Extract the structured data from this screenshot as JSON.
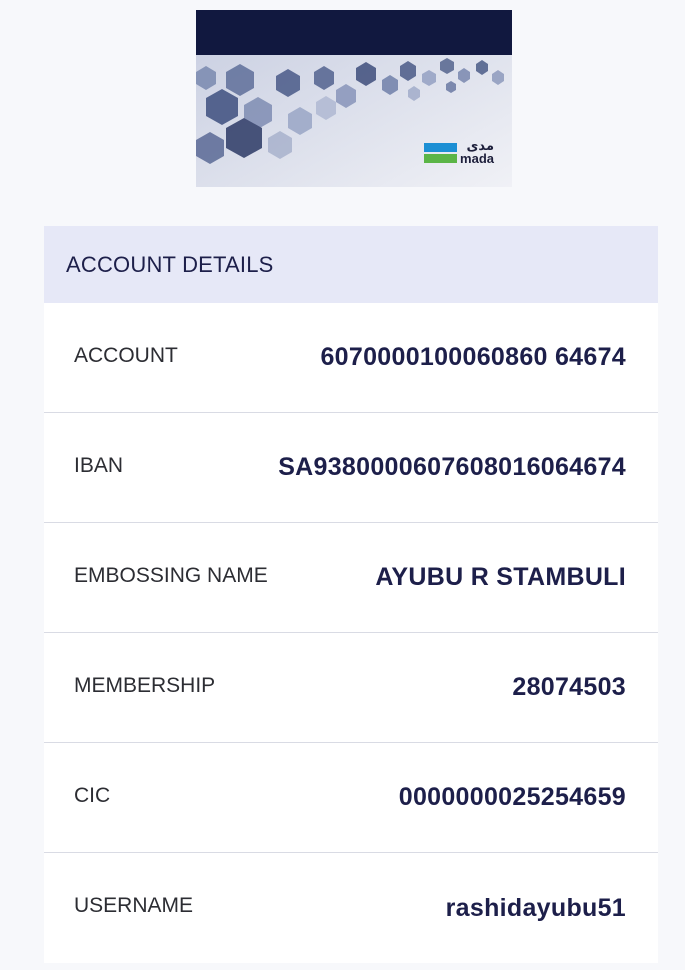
{
  "card": {
    "brand_name": "mada",
    "brand_name_ar": "مدى",
    "colors": {
      "top_band": "#11183f",
      "brand_blue": "#1c8fd4",
      "brand_green": "#5bb547"
    }
  },
  "account_details": {
    "header": "ACCOUNT DETAILS",
    "rows": [
      {
        "label": "ACCOUNT",
        "value": "6070000100060860 64674"
      },
      {
        "label": "IBAN",
        "value": "SA9380000607608016064674"
      },
      {
        "label": "EMBOSSING NAME",
        "value": "AYUBU R STAMBULI"
      },
      {
        "label": "MEMBERSHIP",
        "value": "28074503"
      },
      {
        "label": "CIC",
        "value": "0000000025254659"
      },
      {
        "label": "USERNAME",
        "value": "rashidayubu51"
      }
    ]
  }
}
